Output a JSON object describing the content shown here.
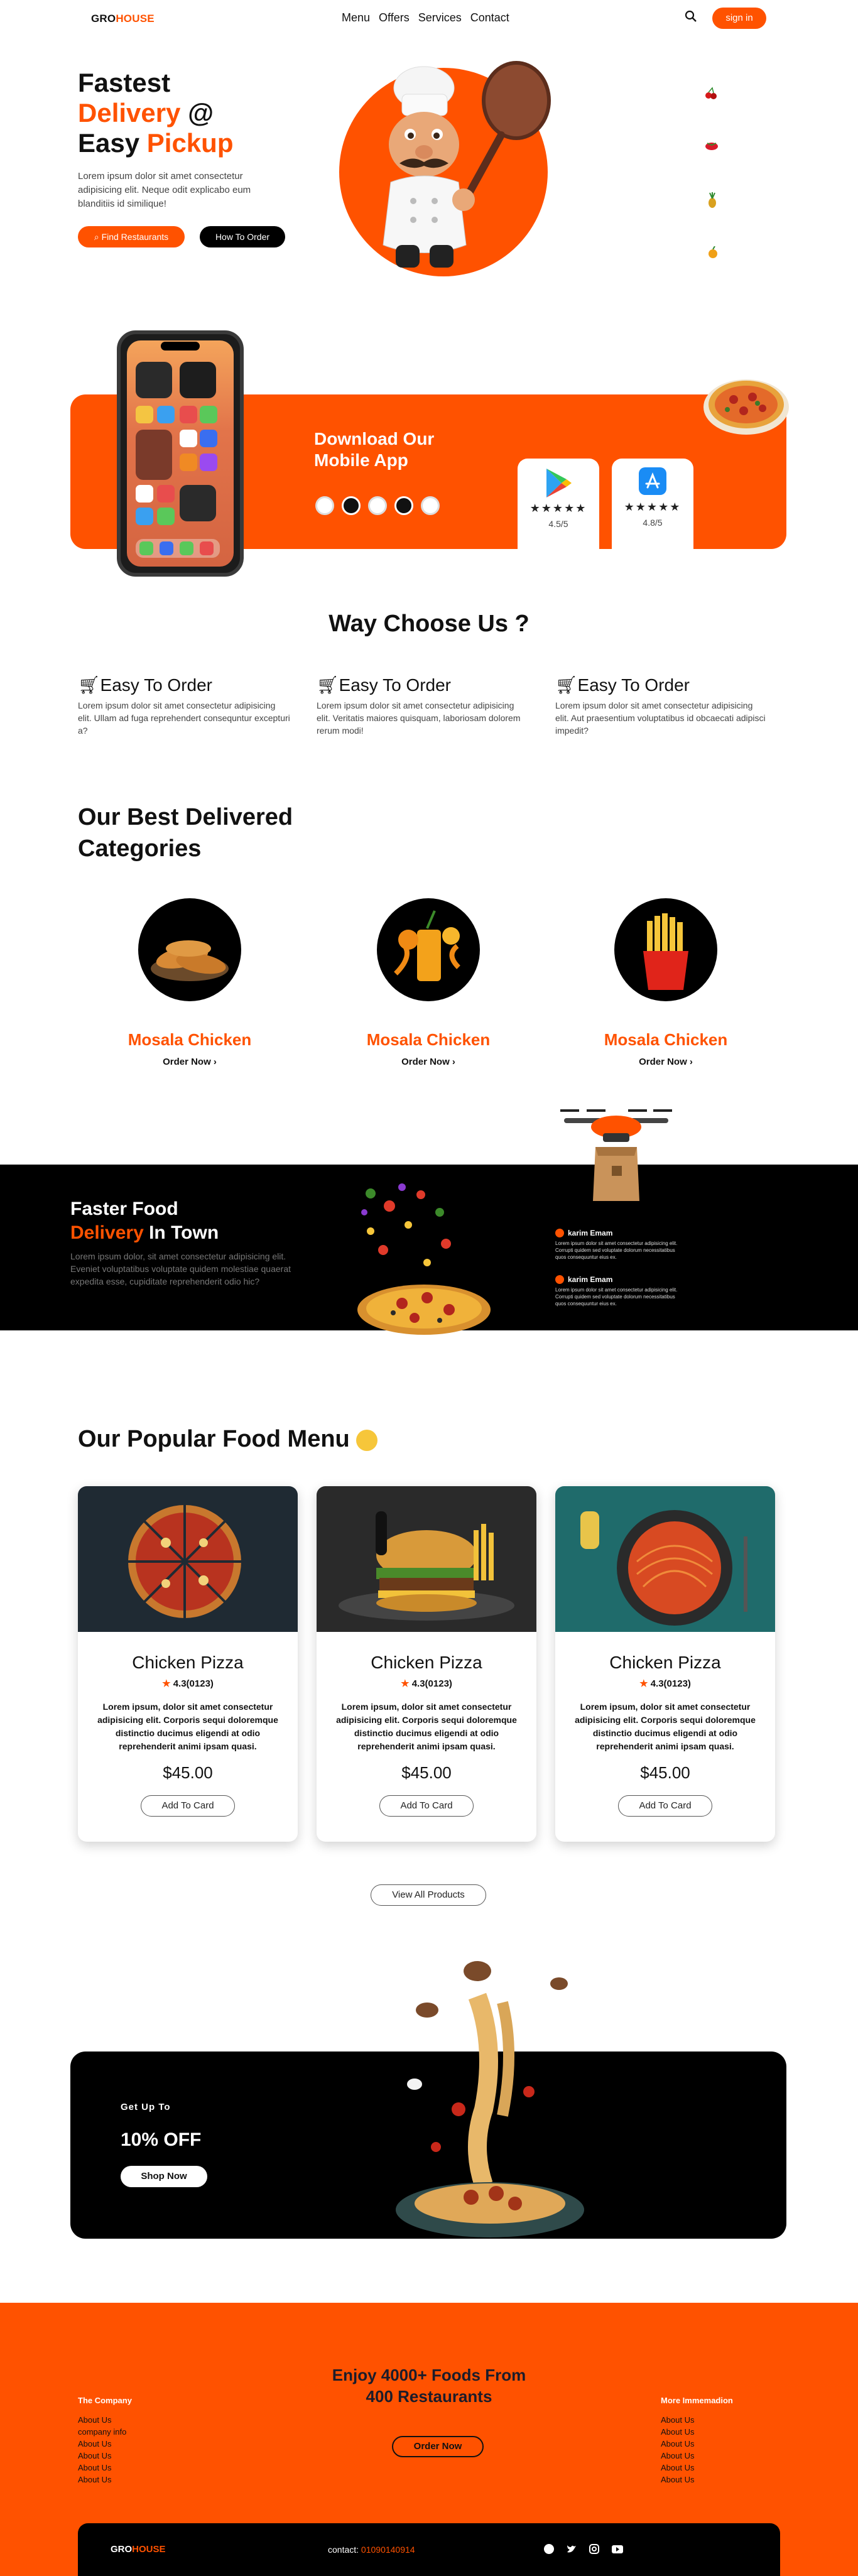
{
  "header": {
    "logo_a": "GRO",
    "logo_b": "HOUSE",
    "nav": [
      "Menu",
      "Offers",
      "Services",
      "Contact"
    ],
    "sign_in": "sign in"
  },
  "hero": {
    "line1": "Fastest",
    "line2a": "Delivery",
    "line2b": " @",
    "line3a": "Easy ",
    "line3b": "Pickup",
    "text": "Lorem ipsum dolor sit amet consectetur adipisicing elit. Neque odit explicabo eum blanditiis id similique!",
    "btn_find": "Find Restaurants",
    "btn_how": "How To Order"
  },
  "download": {
    "title1": "Download Our",
    "title2": "Mobile App",
    "play_rating": "4.5/5",
    "app_rating": "4.8/5",
    "stars": "★★★★★"
  },
  "why": {
    "title": "Way Choose Us ?",
    "features": [
      {
        "title": "Easy To Order",
        "text": "Lorem ipsum dolor sit amet consectetur adipisicing elit. Ullam ad fuga reprehendert consequntur excepturi a?"
      },
      {
        "title": "Easy To Order",
        "text": "Lorem ipsum dolor sit amet consectetur adipisicing elit. Veritatis maiores quisquam, laboriosam dolorem rerum modi!"
      },
      {
        "title": "Easy To Order",
        "text": "Lorem ipsum dolor sit amet consectetur adipisicing elit. Aut praesentium voluptatibus id obcaecati adipisci impedit?"
      }
    ]
  },
  "categories": {
    "title1": "Our Best Delivered",
    "title2": "Categories",
    "items": [
      {
        "name": "Mosala Chicken",
        "link": "Order Now"
      },
      {
        "name": "Mosala Chicken",
        "link": "Order Now"
      },
      {
        "name": "Mosala Chicken",
        "link": "Order Now"
      }
    ]
  },
  "faster": {
    "line1": "Faster Food",
    "line2a": "Delivery",
    "line2b": " In Town",
    "text": "Lorem ipsum dolor, sit amet consectetur adipisicing elit. Eveniet voluptatibus voluptate quidem molestiae quaerat expedita esse, cupiditate reprehenderit odio hic?",
    "reviews": [
      {
        "name": "karim Emam",
        "text": "Lorem ipsum dolor sit amet consectetur adipisicing elit. Corrupti quidem sed voluptate dolorum necessitatibus quos consequuntur eius ex."
      },
      {
        "name": "karim Emam",
        "text": "Lorem ipsum dolor sit amet consectetur adipisicing elit. Corrupti quidem sed voluptate dolorum necessitatibus quos consequuntur eius ex."
      }
    ]
  },
  "menu": {
    "title": "Our Popular Food Menu",
    "cards": [
      {
        "name": "Chicken Pizza",
        "rating": "4.3(0123)",
        "desc": "Lorem ipsum, dolor sit amet consectetur adipisicing elit. Corporis sequi doloremque distinctio ducimus eligendi at odio reprehenderit animi ipsam quasi.",
        "price": "$45.00",
        "btn": "Add To Card"
      },
      {
        "name": "Chicken Pizza",
        "rating": "4.3(0123)",
        "desc": "Lorem ipsum, dolor sit amet consectetur adipisicing elit. Corporis sequi doloremque distinctio ducimus eligendi at odio reprehenderit animi ipsam quasi.",
        "price": "$45.00",
        "btn": "Add To Card"
      },
      {
        "name": "Chicken Pizza",
        "rating": "4.3(0123)",
        "desc": "Lorem ipsum, dolor sit amet consectetur adipisicing elit. Corporis sequi doloremque distinctio ducimus eligendi at odio reprehenderit animi ipsam quasi.",
        "price": "$45.00",
        "btn": "Add To Card"
      }
    ],
    "view_all": "View All Products"
  },
  "promo": {
    "small": "Get Up To",
    "big": "10% OFF",
    "btn": "Shop Now"
  },
  "footer": {
    "headline1": "Enjoy 4000+ Foods From",
    "headline2": "400 Restaurants",
    "order_btn": "Order Now",
    "col1_title": "The Company",
    "col1": [
      "About Us",
      "company info",
      "About Us",
      "About Us",
      "About Us",
      "About Us"
    ],
    "col2_title": "More Immemadion",
    "col2": [
      "About Us",
      "About Us",
      "About Us",
      "About Us",
      "About Us",
      "About Us"
    ],
    "bar_logo_a": "GRO",
    "bar_logo_b": "HOUSE",
    "contact_label": "contact: ",
    "contact_phone": "01090140914"
  },
  "colors": {
    "accent": "#ff5200",
    "dark": "#000000"
  }
}
